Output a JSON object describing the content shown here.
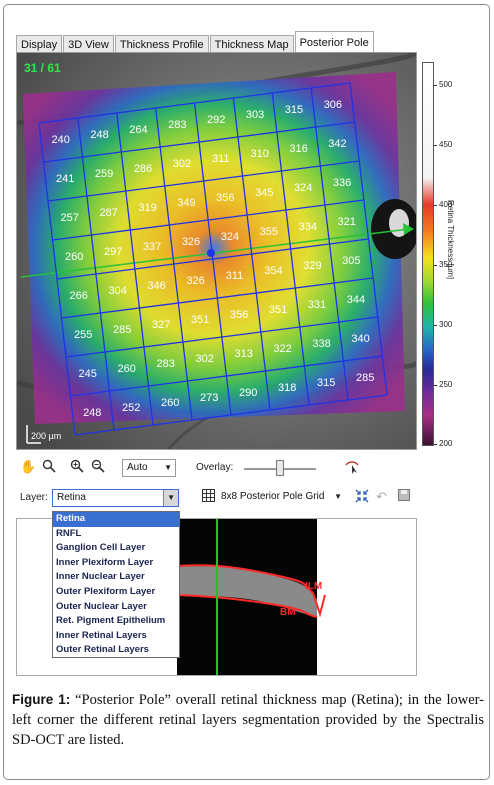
{
  "tabs": [
    {
      "label": "Display",
      "active": false
    },
    {
      "label": "3D View",
      "active": false
    },
    {
      "label": "Thickness Profile",
      "active": false
    },
    {
      "label": "Thickness Map",
      "active": false
    },
    {
      "label": "Posterior Pole",
      "active": true
    }
  ],
  "viewer": {
    "scan_counter": "31 / 61",
    "scale_bar_label": "200 µm",
    "grid_values": [
      [
        240,
        248,
        264,
        283,
        292,
        303,
        315,
        306
      ],
      [
        241,
        259,
        286,
        302,
        311,
        310,
        316,
        342
      ],
      [
        257,
        287,
        319,
        349,
        356,
        345,
        324,
        336
      ],
      [
        260,
        297,
        337,
        326,
        324,
        355,
        334,
        321
      ],
      [
        266,
        304,
        346,
        326,
        311,
        354,
        329,
        305
      ],
      [
        255,
        285,
        327,
        351,
        356,
        351,
        331,
        344
      ],
      [
        245,
        260,
        283,
        302,
        313,
        322,
        338,
        340
      ],
      [
        248,
        252,
        260,
        273,
        290,
        318,
        315,
        285
      ]
    ]
  },
  "colorbar": {
    "title": "Retina Thickness [µm]",
    "tick_labels": [
      "500",
      "450",
      "400",
      "350",
      "300",
      "250",
      "200"
    ]
  },
  "toolbar": {
    "zoom_mode": "Auto",
    "overlay_label": "Overlay:",
    "layer_label": "Layer:",
    "layer_selected": "Retina",
    "grid_select": "8x8 Posterior Pole Grid"
  },
  "layer_options": [
    "Retina",
    "RNFL",
    "Ganglion Cell Layer",
    "Inner Plexiform Layer",
    "Inner Nuclear Layer",
    "Outer Plexiform Layer",
    "Outer Nuclear Layer",
    "Ret. Pigment Epithelium",
    "Inner Retinal Layers",
    "Outer Retinal Layers"
  ],
  "oct": {
    "ilm_label": "ILM",
    "bm_label": "BM"
  },
  "caption": {
    "label": "Figure 1:",
    "text": "“Posterior Pole” overall retinal thickness map (Retina); in the lower-left corner the different retinal layers segmentation provided by the Spectralis SD-OCT are listed."
  },
  "colors": {
    "grid_line": "#1f33e8",
    "scan_counter": "#2ee84a",
    "selection": "#3a6fd2",
    "oct_marker": "#22c02a",
    "boundary": "#ff2a2a"
  }
}
